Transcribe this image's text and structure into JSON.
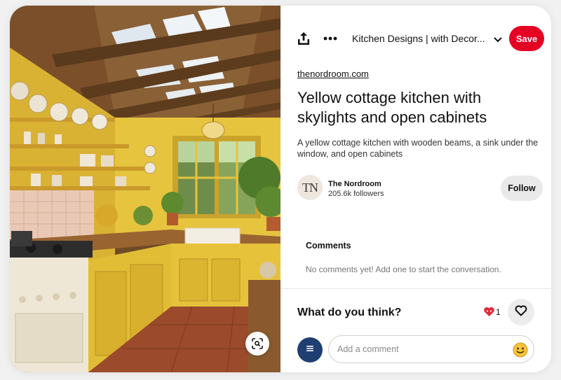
{
  "toolbar": {
    "board_name": "Kitchen Designs | with Decor...",
    "save_label": "Save"
  },
  "pin": {
    "source": "thenordroom.com",
    "title": "Yellow cottage kitchen with skylights and open cabinets",
    "description": "A yellow cottage kitchen with wooden beams, a sink under the window, and open cabinets"
  },
  "creator": {
    "avatar_text": "TN",
    "name": "The Nordroom",
    "followers": "205.6k followers",
    "follow_label": "Follow"
  },
  "comments": {
    "heading": "Comments",
    "empty_message": "No comments yet! Add one to start the conversation."
  },
  "feedback": {
    "prompt": "What do you think?",
    "reaction_count": "1",
    "reaction_icon": "heart-eyes-emoji",
    "react_icon": "heart-outline-icon"
  },
  "composer": {
    "avatar_icon": "menu-lines-icon",
    "placeholder": "Add a comment",
    "emoji_icon": "smiley-face-icon"
  },
  "image": {
    "visual_search_icon": "visual-search-icon"
  },
  "colors": {
    "save_red": "#e60023",
    "avatar_blue": "#1f3f73",
    "kitchen_yellow": "#e7c43e"
  }
}
